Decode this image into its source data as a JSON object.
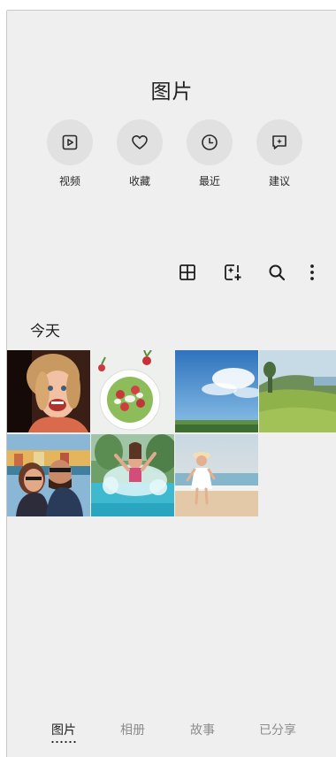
{
  "header": {
    "title": "图片"
  },
  "quick_actions": [
    {
      "label": "视频",
      "icon": "video-icon"
    },
    {
      "label": "收藏",
      "icon": "heart-icon"
    },
    {
      "label": "最近",
      "icon": "clock-icon"
    },
    {
      "label": "建议",
      "icon": "suggestion-icon"
    }
  ],
  "toolbar": {
    "icons": [
      "grid-view-icon",
      "create-icon",
      "search-icon",
      "more-options-icon"
    ]
  },
  "section": {
    "title": "今天"
  },
  "photos": [
    {
      "subject": "child-portrait"
    },
    {
      "subject": "salad-plate"
    },
    {
      "subject": "sky-landscape"
    },
    {
      "subject": "coastal-field"
    },
    {
      "subject": "couple-selfie"
    },
    {
      "subject": "pool-splash"
    },
    {
      "subject": "beach-girl"
    }
  ],
  "bottom_nav": {
    "items": [
      {
        "label": "图片",
        "active": true
      },
      {
        "label": "相册",
        "active": false
      },
      {
        "label": "故事",
        "active": false
      },
      {
        "label": "已分享",
        "active": false
      }
    ]
  },
  "colors": {
    "background": "#efefef",
    "circle": "#e1e1e1",
    "text": "#1e1e1e",
    "inactive_tab": "#8c8c8c"
  }
}
